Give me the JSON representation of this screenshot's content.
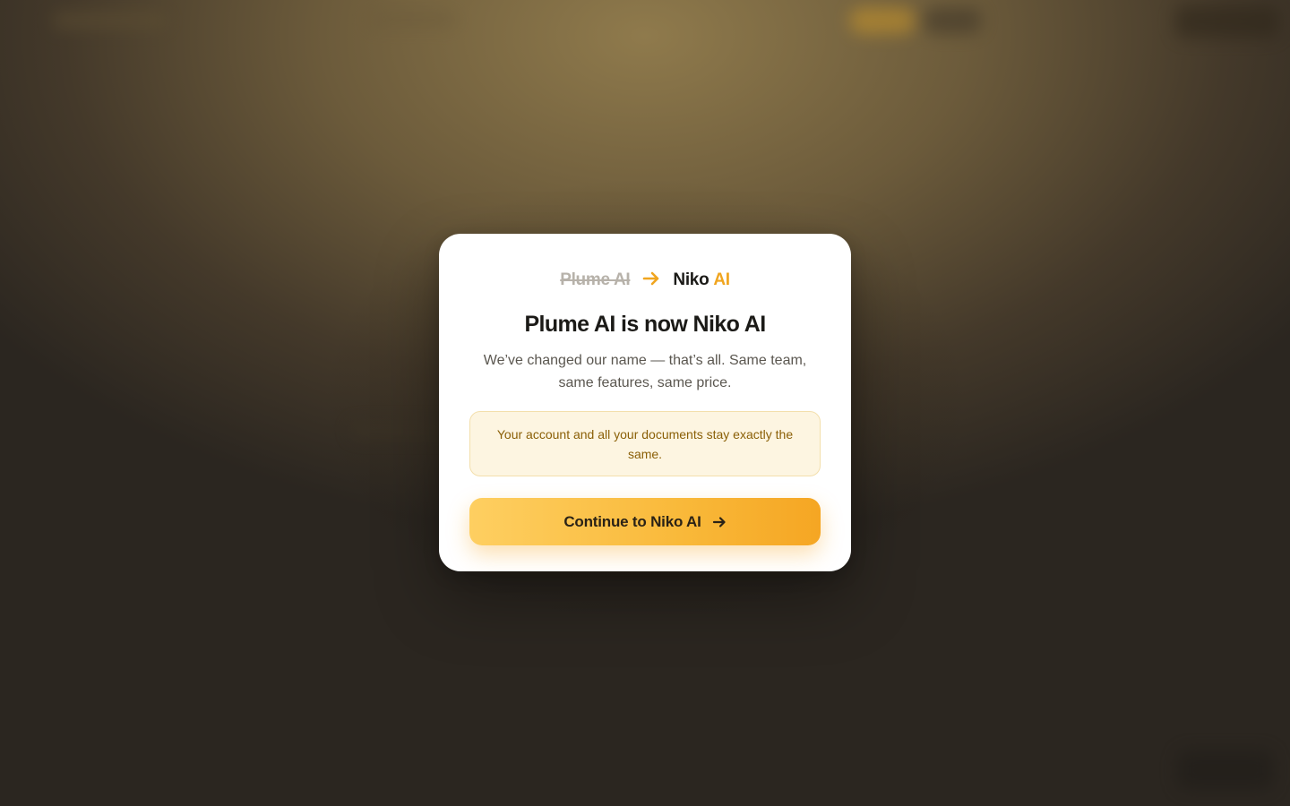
{
  "rename": {
    "old_name": "Plume AI",
    "new_name": "Niko",
    "new_name_accent": "AI"
  },
  "modal": {
    "title": "Plume AI is now Niko AI",
    "subtitle": "We’ve changed our name — that’s all. Same team, same features, same price.",
    "notice": "Your account and all your documents stay exactly the same.",
    "continue_label": "Continue to Niko AI"
  },
  "icons": {
    "rename_arrow": "arrow-right-icon",
    "button_arrow": "arrow-right-icon"
  },
  "colors": {
    "accent": "#f0a51f",
    "notice_bg": "#fdf5e1",
    "notice_text": "#8a5f06"
  }
}
